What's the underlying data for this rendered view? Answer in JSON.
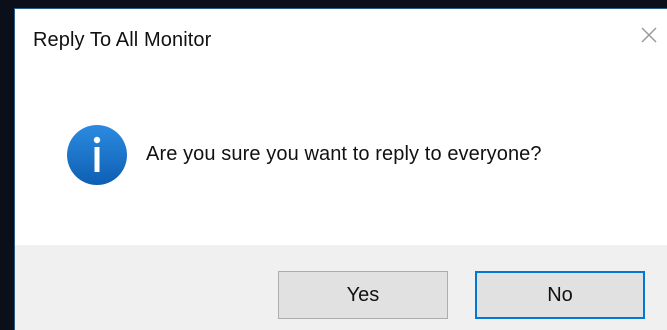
{
  "window": {
    "title": "Reply To All Monitor",
    "close_icon": "close-icon"
  },
  "dialog": {
    "icon": "info-icon",
    "message": "Are you sure you want to reply to everyone?"
  },
  "buttons": {
    "yes_label": "Yes",
    "no_label": "No",
    "default_button": "No"
  },
  "colors": {
    "accent": "#0078d7",
    "info_icon_fill": "#1a73c9",
    "footer_bg": "#f0f0f0",
    "button_bg": "#e1e1e1"
  }
}
